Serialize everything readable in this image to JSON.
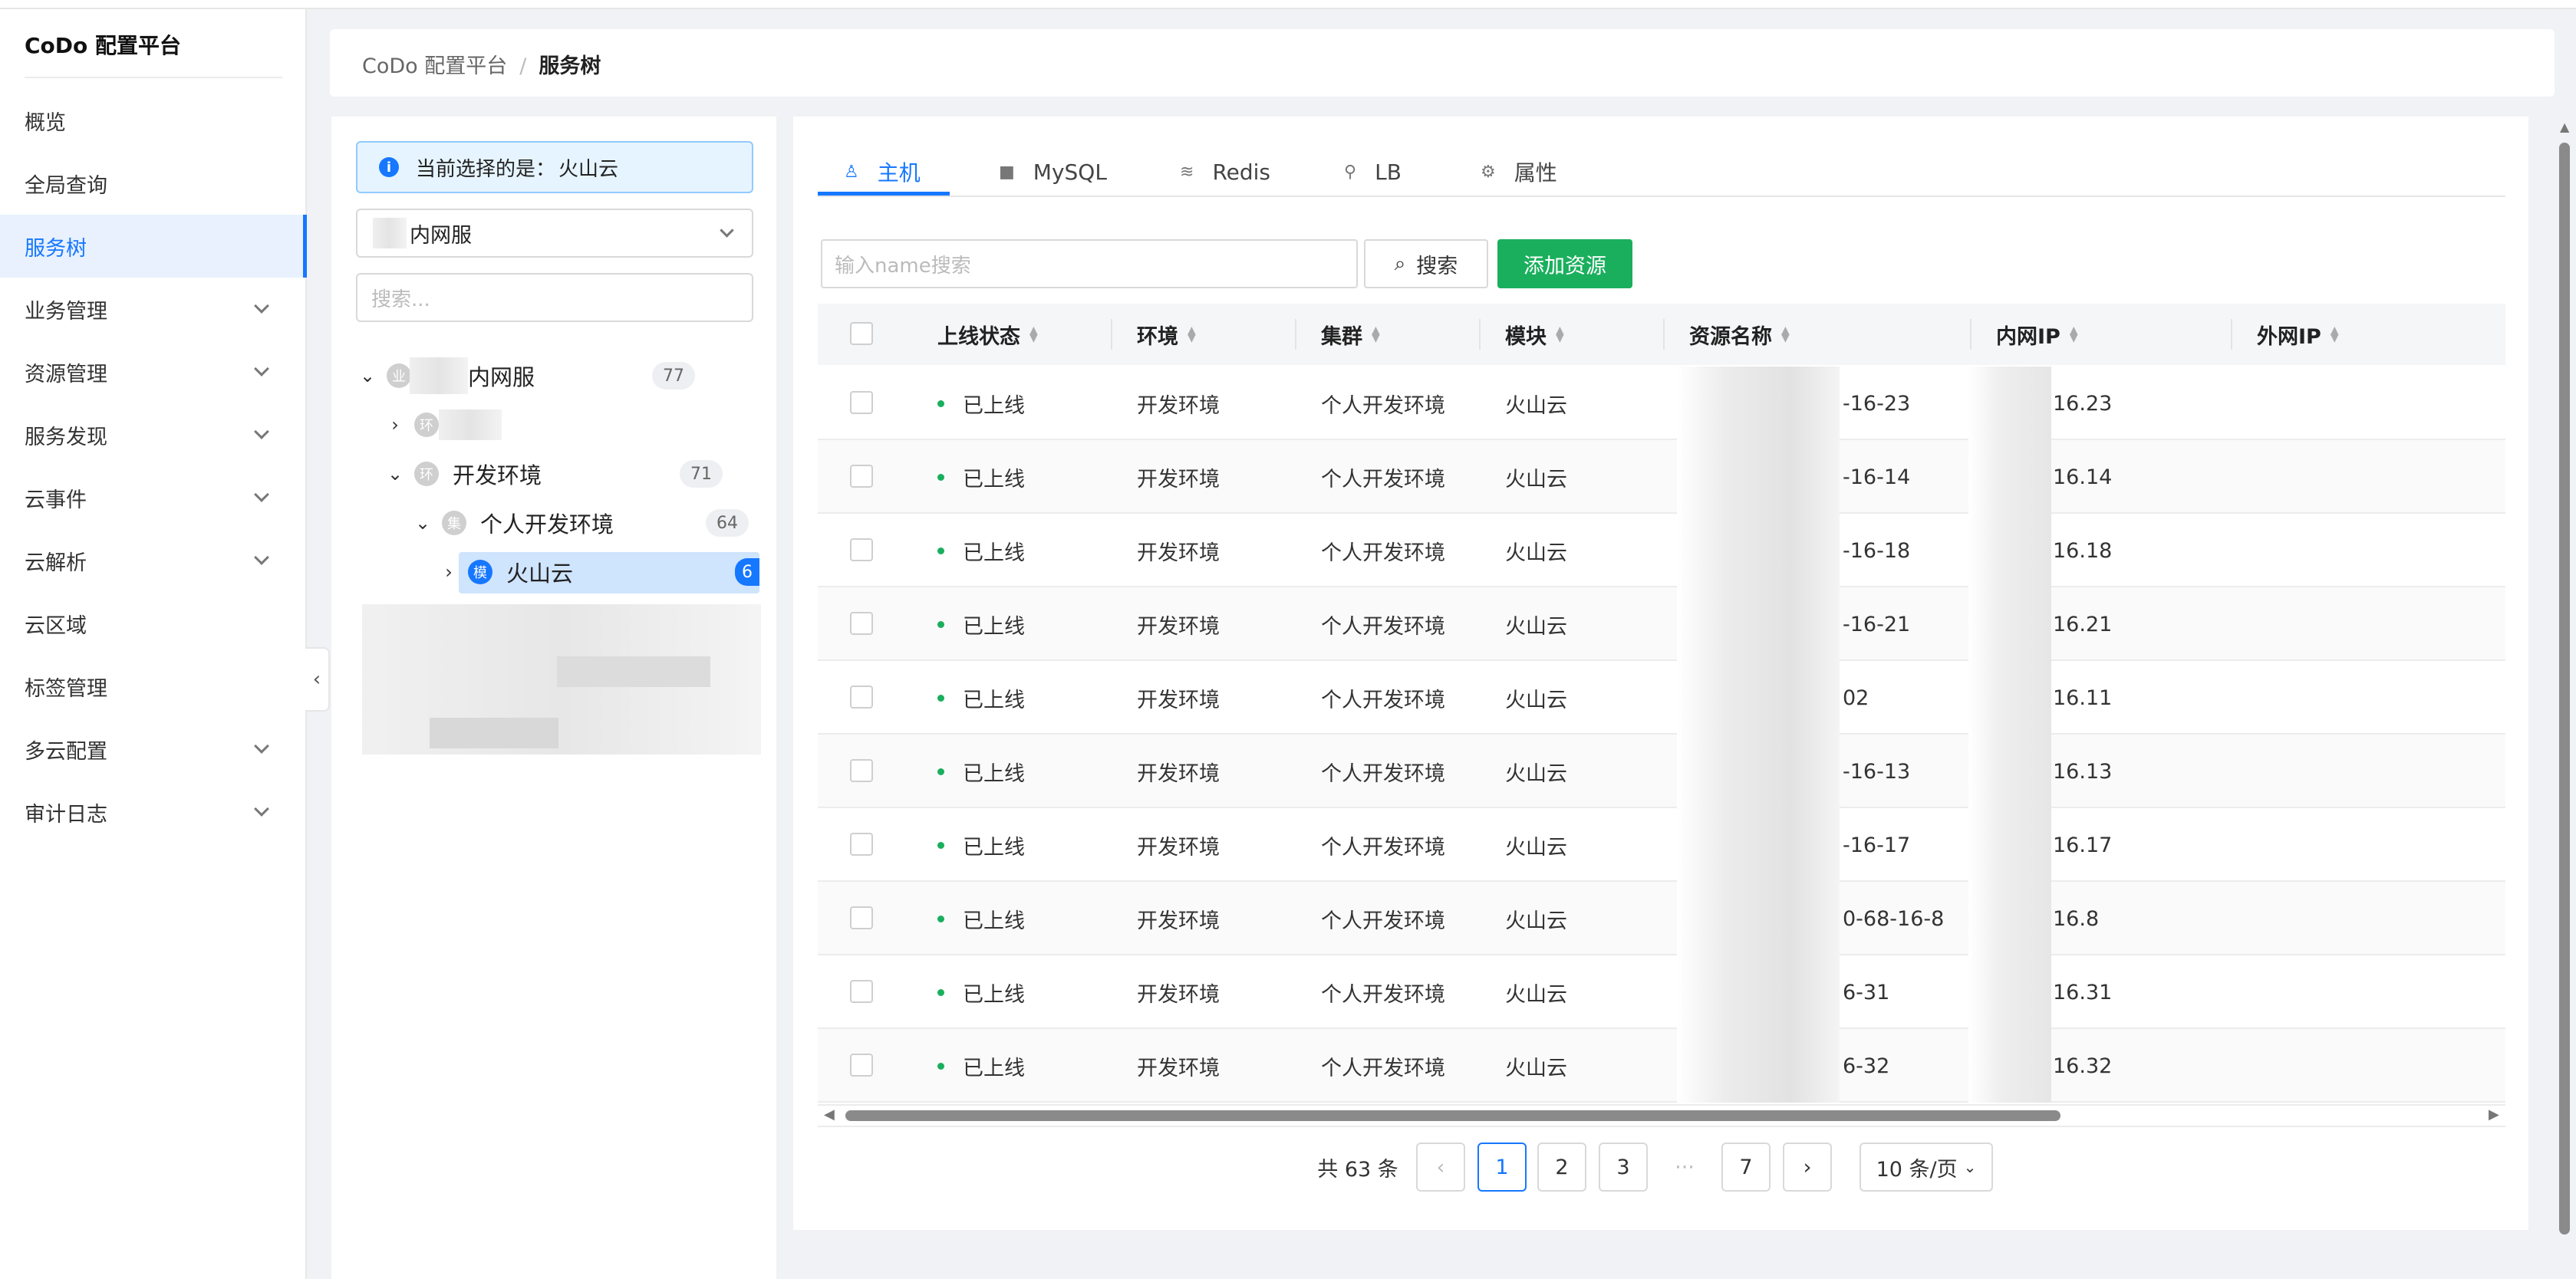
{
  "app": {
    "title": "CoDo 配置平台"
  },
  "sidebar": {
    "items": [
      {
        "label": "概览",
        "has_children": false
      },
      {
        "label": "全局查询",
        "has_children": false
      },
      {
        "label": "服务树",
        "has_children": false,
        "active": true
      },
      {
        "label": "业务管理",
        "has_children": true
      },
      {
        "label": "资源管理",
        "has_children": true
      },
      {
        "label": "服务发现",
        "has_children": true
      },
      {
        "label": "云事件",
        "has_children": true
      },
      {
        "label": "云解析",
        "has_children": true
      },
      {
        "label": "云区域",
        "has_children": false
      },
      {
        "label": "标签管理",
        "has_children": false
      },
      {
        "label": "多云配置",
        "has_children": true
      },
      {
        "label": "审计日志",
        "has_children": true
      }
    ],
    "collapse_icon": "‹"
  },
  "breadcrumb": {
    "root": "CoDo 配置平台",
    "separator": "/",
    "current": "服务树"
  },
  "tree_panel": {
    "info_icon": "i",
    "info_label": "当前选择的是：",
    "info_value": "火山云",
    "business_select": "内网服",
    "search_placeholder": "搜索...",
    "nodes": {
      "root": {
        "label": "内网服",
        "badge": "业",
        "count": "77"
      },
      "env1": {
        "label": "",
        "badge": "环"
      },
      "env2": {
        "label": "开发环境",
        "badge": "环",
        "count": "71"
      },
      "cluster": {
        "label": "个人开发环境",
        "badge": "集",
        "count": "64"
      },
      "module": {
        "label": "火山云",
        "badge": "模",
        "count": "6"
      }
    }
  },
  "tabs": [
    {
      "label": "主机",
      "icon": "linux-icon",
      "glyph": "♙",
      "active": true
    },
    {
      "label": "MySQL",
      "icon": "database-icon",
      "glyph": "■"
    },
    {
      "label": "Redis",
      "icon": "redis-icon",
      "glyph": "≋"
    },
    {
      "label": "LB",
      "icon": "lb-icon",
      "glyph": "⚲"
    },
    {
      "label": "属性",
      "icon": "gear-icon",
      "glyph": "⚙"
    }
  ],
  "toolbar": {
    "search_placeholder": "输入name搜索",
    "search_label": "搜索",
    "search_icon": "⌕",
    "add_label": "添加资源"
  },
  "table": {
    "columns": [
      "上线状态",
      "环境",
      "集群",
      "模块",
      "资源名称",
      "内网IP",
      "外网IP"
    ],
    "rows": [
      {
        "status": "已上线",
        "env": "开发环境",
        "cluster": "个人开发环境",
        "module": "火山云",
        "name": "-16-23",
        "inner_ip": "16.23",
        "outer_ip": ""
      },
      {
        "status": "已上线",
        "env": "开发环境",
        "cluster": "个人开发环境",
        "module": "火山云",
        "name": "-16-14",
        "inner_ip": "16.14",
        "outer_ip": ""
      },
      {
        "status": "已上线",
        "env": "开发环境",
        "cluster": "个人开发环境",
        "module": "火山云",
        "name": "-16-18",
        "inner_ip": "16.18",
        "outer_ip": ""
      },
      {
        "status": "已上线",
        "env": "开发环境",
        "cluster": "个人开发环境",
        "module": "火山云",
        "name": "-16-21",
        "inner_ip": "16.21",
        "outer_ip": ""
      },
      {
        "status": "已上线",
        "env": "开发环境",
        "cluster": "个人开发环境",
        "module": "火山云",
        "name": "02",
        "inner_ip": "16.11",
        "outer_ip": ""
      },
      {
        "status": "已上线",
        "env": "开发环境",
        "cluster": "个人开发环境",
        "module": "火山云",
        "name": "-16-13",
        "inner_ip": "16.13",
        "outer_ip": ""
      },
      {
        "status": "已上线",
        "env": "开发环境",
        "cluster": "个人开发环境",
        "module": "火山云",
        "name": "-16-17",
        "inner_ip": "16.17",
        "outer_ip": ""
      },
      {
        "status": "已上线",
        "env": "开发环境",
        "cluster": "个人开发环境",
        "module": "火山云",
        "name": "0-68-16-8",
        "inner_ip": "16.8",
        "outer_ip": ""
      },
      {
        "status": "已上线",
        "env": "开发环境",
        "cluster": "个人开发环境",
        "module": "火山云",
        "name": "6-31",
        "inner_ip": "16.31",
        "outer_ip": ""
      },
      {
        "status": "已上线",
        "env": "开发环境",
        "cluster": "个人开发环境",
        "module": "火山云",
        "name": "6-32",
        "inner_ip": "16.32",
        "outer_ip": ""
      }
    ]
  },
  "pagination": {
    "total": "共 63 条",
    "prev": "‹",
    "next": "›",
    "pages": [
      "1",
      "2",
      "3",
      "···",
      "7"
    ],
    "current": "1",
    "page_size": "10 条/页"
  },
  "colors": {
    "accent": "#1677ff",
    "success": "#1aaf5d"
  }
}
